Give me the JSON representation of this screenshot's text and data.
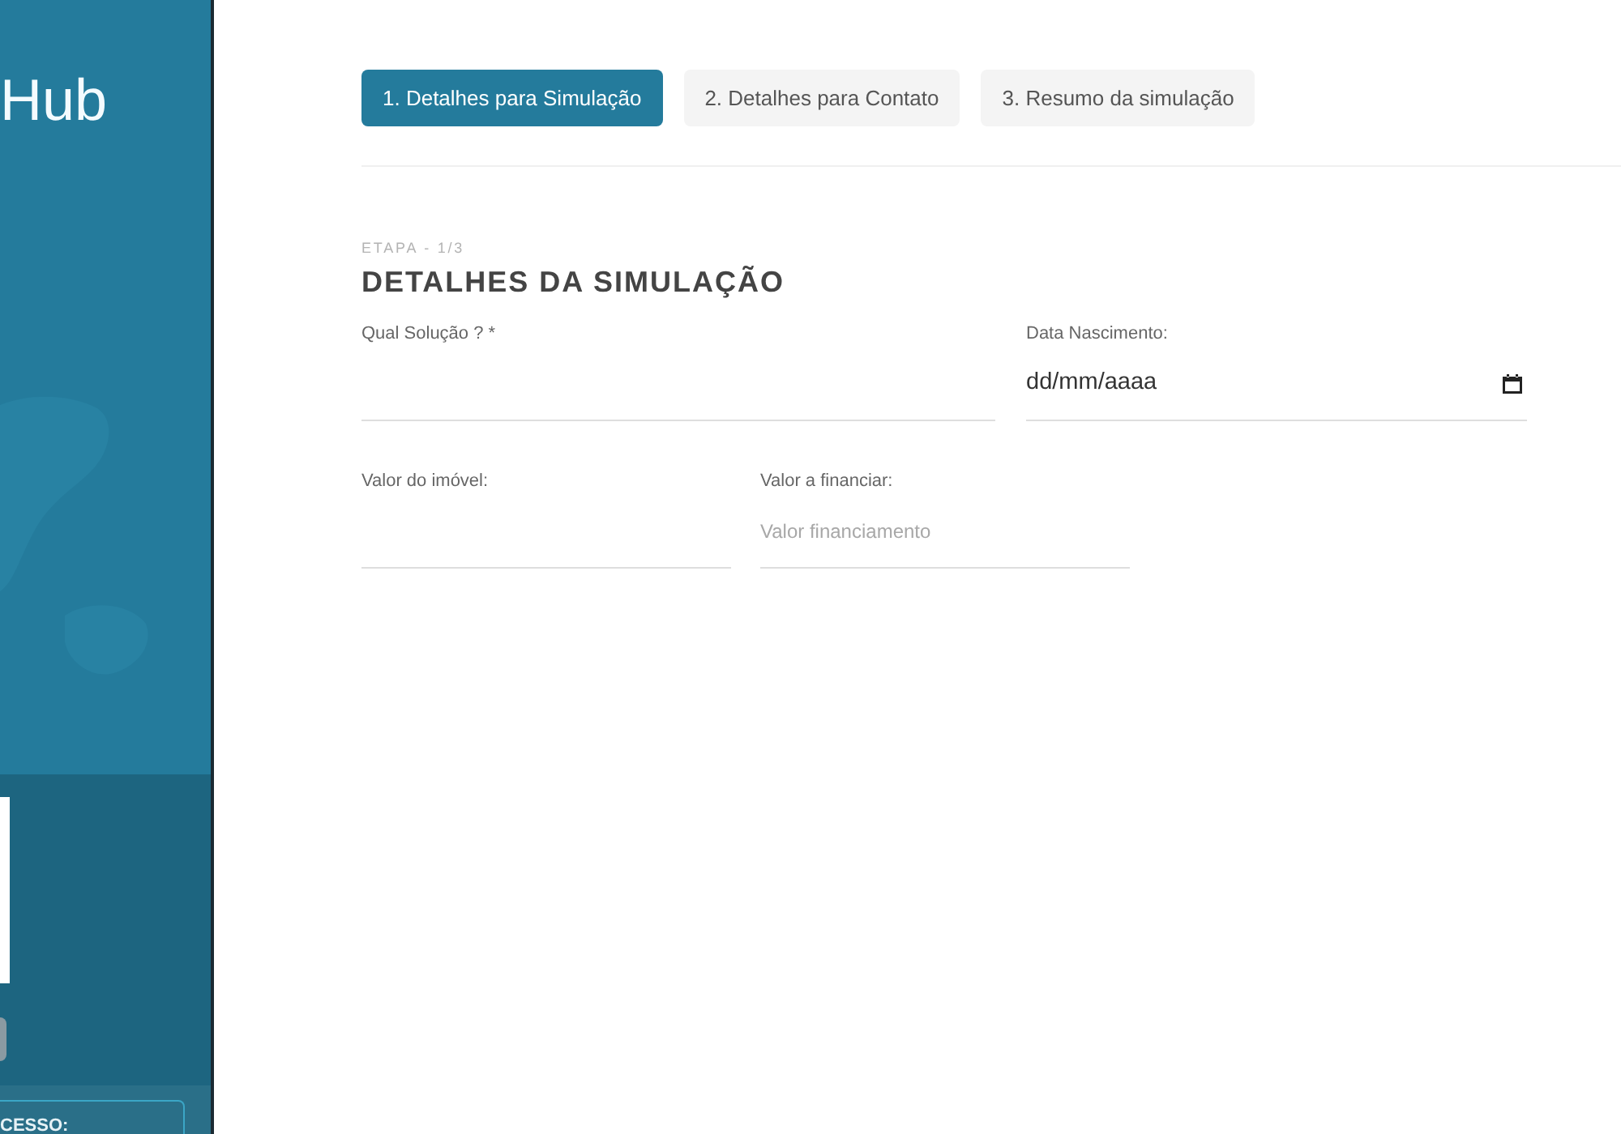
{
  "sidebar": {
    "logo_text": "Hub",
    "access_box": {
      "label": "CESSO:"
    }
  },
  "steps": [
    {
      "label": "1. Detalhes para Simulação",
      "selected": true
    },
    {
      "label": "2. Detalhes para Contato",
      "selected": false
    },
    {
      "label": "3. Resumo da simulação",
      "selected": false
    }
  ],
  "form": {
    "step_caption": "ETAPA - 1/3",
    "title": "DETALHES DA SIMULAÇÃO",
    "rows": [
      [
        {
          "kind": "text",
          "label": "Qual Solução ? *"
        },
        {
          "kind": "date",
          "label": "Data Nascimento:",
          "value": "dd/mm/aaaa"
        }
      ],
      [
        {
          "kind": "text",
          "label": "Valor do imóvel:"
        },
        {
          "kind": "text",
          "label": "Valor a financiar:",
          "placeholder": "Valor financiamento"
        }
      ]
    ]
  }
}
